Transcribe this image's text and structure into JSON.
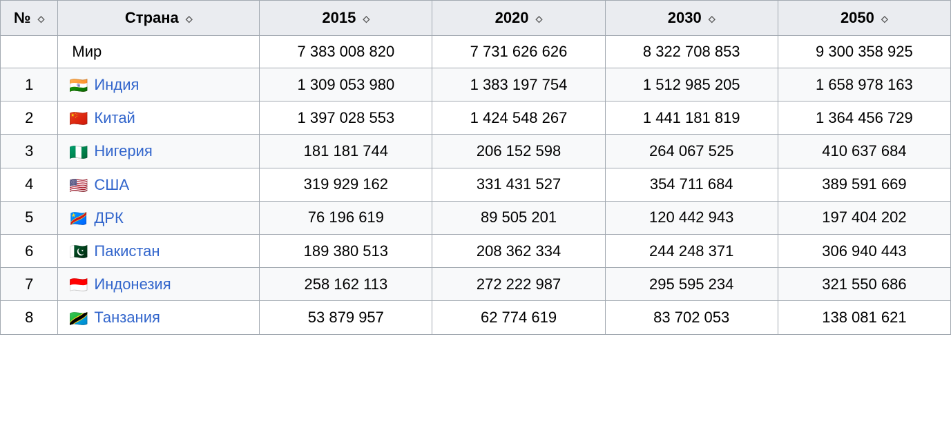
{
  "table": {
    "headers": [
      {
        "label": "№",
        "sort": true,
        "key": "no"
      },
      {
        "label": "Страна",
        "sort": true,
        "key": "country"
      },
      {
        "label": "2015",
        "sort": true,
        "key": "y2015"
      },
      {
        "label": "2020",
        "sort": true,
        "key": "y2020"
      },
      {
        "label": "2030",
        "sort": true,
        "key": "y2030"
      },
      {
        "label": "2050",
        "sort": true,
        "key": "y2050"
      }
    ],
    "world_row": {
      "name": "Мир",
      "y2015": "7 383 008 820",
      "y2020": "7 731 626 626",
      "y2030": "8 322 708 853",
      "y2050": "9 300 358 925"
    },
    "rows": [
      {
        "no": "1",
        "flag": "🇮🇳",
        "country": "Индия",
        "y2015": "1 309 053 980",
        "y2020": "1 383 197 754",
        "y2030": "1 512 985 205",
        "y2050": "1 658 978 163"
      },
      {
        "no": "2",
        "flag": "🇨🇳",
        "country": "Китай",
        "y2015": "1 397 028 553",
        "y2020": "1 424 548 267",
        "y2030": "1 441 181 819",
        "y2050": "1 364 456 729"
      },
      {
        "no": "3",
        "flag": "🇳🇬",
        "country": "Нигерия",
        "y2015": "181 181 744",
        "y2020": "206 152 598",
        "y2030": "264 067 525",
        "y2050": "410 637 684"
      },
      {
        "no": "4",
        "flag": "🇺🇸",
        "country": "США",
        "y2015": "319 929 162",
        "y2020": "331 431 527",
        "y2030": "354 711 684",
        "y2050": "389 591 669"
      },
      {
        "no": "5",
        "flag": "🇨🇩",
        "country": "ДРК",
        "y2015": "76 196 619",
        "y2020": "89 505 201",
        "y2030": "120 442 943",
        "y2050": "197 404 202"
      },
      {
        "no": "6",
        "flag": "🇵🇰",
        "country": "Пакистан",
        "y2015": "189 380 513",
        "y2020": "208 362 334",
        "y2030": "244 248 371",
        "y2050": "306 940 443"
      },
      {
        "no": "7",
        "flag": "🇮🇩",
        "country": "Индонезия",
        "y2015": "258 162 113",
        "y2020": "272 222 987",
        "y2030": "295 595 234",
        "y2050": "321 550 686"
      },
      {
        "no": "8",
        "flag": "🇹🇿",
        "country": "Танзания",
        "y2015": "53 879 957",
        "y2020": "62 774 619",
        "y2030": "83 702 053",
        "y2050": "138 081 621"
      }
    ],
    "sort_icon": "⬦"
  }
}
